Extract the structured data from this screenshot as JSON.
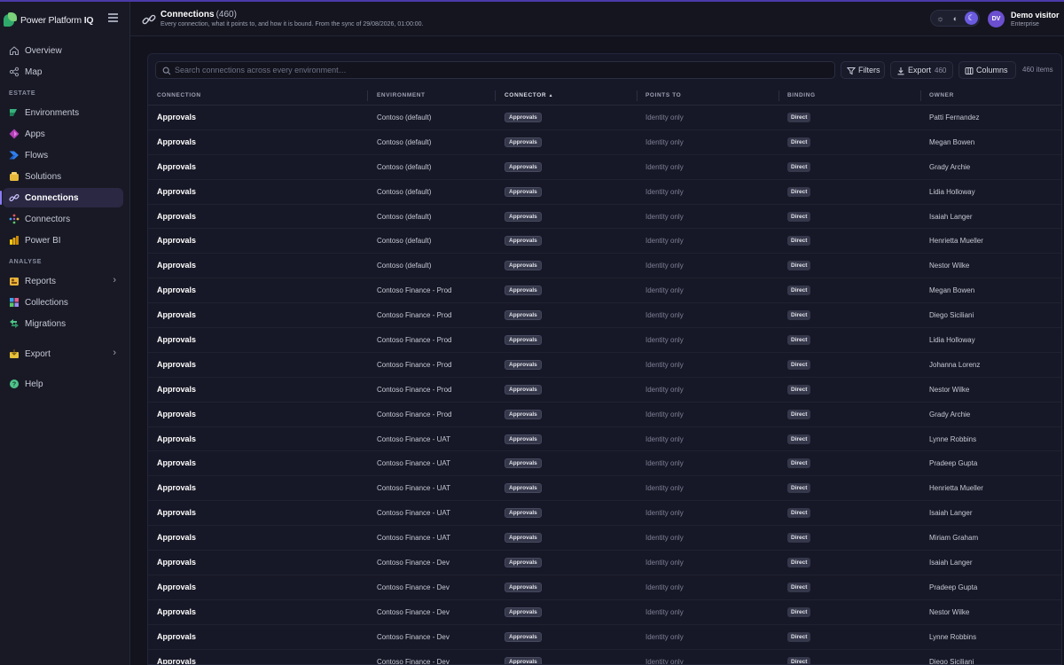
{
  "sidebar": {
    "brand": {
      "name": "Power Platform",
      "suffix": "IQ"
    },
    "top_items": [
      {
        "label": "Overview",
        "icon": "home-icon"
      },
      {
        "label": "Map",
        "icon": "share-nodes-icon"
      }
    ],
    "sections": [
      {
        "title": "ESTATE",
        "items": [
          {
            "label": "Environments",
            "icon": "environments-icon"
          },
          {
            "label": "Apps",
            "icon": "apps-icon"
          },
          {
            "label": "Flows",
            "icon": "flows-icon"
          },
          {
            "label": "Solutions",
            "icon": "solutions-icon"
          },
          {
            "label": "Connections",
            "icon": "connections-icon",
            "active": true
          },
          {
            "label": "Connectors",
            "icon": "connectors-icon"
          },
          {
            "label": "Power BI",
            "icon": "powerbi-icon"
          }
        ]
      },
      {
        "title": "ANALYSE",
        "items": [
          {
            "label": "Reports",
            "icon": "reports-icon",
            "chevron": true
          },
          {
            "label": "Collections",
            "icon": "collections-icon"
          },
          {
            "label": "Migrations",
            "icon": "migrations-icon"
          }
        ]
      }
    ],
    "export": {
      "label": "Export",
      "icon": "export-icon"
    },
    "help": {
      "label": "Help",
      "icon": "help-icon"
    }
  },
  "header": {
    "title": "Connections",
    "count": "(460)",
    "subtitle": "Every connection, what it points to, and how it is bound. From the sync of 29/08/2026, 01:00:00.",
    "user": {
      "initials": "DV",
      "name": "Demo visitor",
      "plan": "Enterprise"
    },
    "theme": {
      "options": [
        "sun-icon",
        "contrast-icon",
        "moon-icon"
      ],
      "selected": "moon-icon"
    }
  },
  "toolbar": {
    "search_placeholder": "Search connections across every environment…",
    "filters_label": "Filters",
    "export_label": "Export",
    "export_count": "460",
    "columns_label": "Columns",
    "items_count": "460 items"
  },
  "table": {
    "columns": [
      "CONNECTION",
      "ENVIRONMENT",
      "CONNECTOR",
      "POINTS TO",
      "BINDING",
      "OWNER"
    ],
    "sorted_column": "CONNECTOR",
    "sort_indicator": "▲",
    "rows": [
      {
        "connection": "Approvals",
        "environment": "Contoso (default)",
        "connector": "Approvals",
        "points_to": "Identity only",
        "binding": "Direct",
        "owner": "Patti Fernandez"
      },
      {
        "connection": "Approvals",
        "environment": "Contoso (default)",
        "connector": "Approvals",
        "points_to": "Identity only",
        "binding": "Direct",
        "owner": "Megan Bowen"
      },
      {
        "connection": "Approvals",
        "environment": "Contoso (default)",
        "connector": "Approvals",
        "points_to": "Identity only",
        "binding": "Direct",
        "owner": "Grady Archie"
      },
      {
        "connection": "Approvals",
        "environment": "Contoso (default)",
        "connector": "Approvals",
        "points_to": "Identity only",
        "binding": "Direct",
        "owner": "Lidia Holloway"
      },
      {
        "connection": "Approvals",
        "environment": "Contoso (default)",
        "connector": "Approvals",
        "points_to": "Identity only",
        "binding": "Direct",
        "owner": "Isaiah Langer"
      },
      {
        "connection": "Approvals",
        "environment": "Contoso (default)",
        "connector": "Approvals",
        "points_to": "Identity only",
        "binding": "Direct",
        "owner": "Henrietta Mueller"
      },
      {
        "connection": "Approvals",
        "environment": "Contoso (default)",
        "connector": "Approvals",
        "points_to": "Identity only",
        "binding": "Direct",
        "owner": "Nestor Wilke"
      },
      {
        "connection": "Approvals",
        "environment": "Contoso Finance - Prod",
        "connector": "Approvals",
        "points_to": "Identity only",
        "binding": "Direct",
        "owner": "Megan Bowen"
      },
      {
        "connection": "Approvals",
        "environment": "Contoso Finance - Prod",
        "connector": "Approvals",
        "points_to": "Identity only",
        "binding": "Direct",
        "owner": "Diego Siciliani"
      },
      {
        "connection": "Approvals",
        "environment": "Contoso Finance - Prod",
        "connector": "Approvals",
        "points_to": "Identity only",
        "binding": "Direct",
        "owner": "Lidia Holloway"
      },
      {
        "connection": "Approvals",
        "environment": "Contoso Finance - Prod",
        "connector": "Approvals",
        "points_to": "Identity only",
        "binding": "Direct",
        "owner": "Johanna Lorenz"
      },
      {
        "connection": "Approvals",
        "environment": "Contoso Finance - Prod",
        "connector": "Approvals",
        "points_to": "Identity only",
        "binding": "Direct",
        "owner": "Nestor Wilke"
      },
      {
        "connection": "Approvals",
        "environment": "Contoso Finance - Prod",
        "connector": "Approvals",
        "points_to": "Identity only",
        "binding": "Direct",
        "owner": "Grady Archie"
      },
      {
        "connection": "Approvals",
        "environment": "Contoso Finance - UAT",
        "connector": "Approvals",
        "points_to": "Identity only",
        "binding": "Direct",
        "owner": "Lynne Robbins"
      },
      {
        "connection": "Approvals",
        "environment": "Contoso Finance - UAT",
        "connector": "Approvals",
        "points_to": "Identity only",
        "binding": "Direct",
        "owner": "Pradeep Gupta"
      },
      {
        "connection": "Approvals",
        "environment": "Contoso Finance - UAT",
        "connector": "Approvals",
        "points_to": "Identity only",
        "binding": "Direct",
        "owner": "Henrietta Mueller"
      },
      {
        "connection": "Approvals",
        "environment": "Contoso Finance - UAT",
        "connector": "Approvals",
        "points_to": "Identity only",
        "binding": "Direct",
        "owner": "Isaiah Langer"
      },
      {
        "connection": "Approvals",
        "environment": "Contoso Finance - UAT",
        "connector": "Approvals",
        "points_to": "Identity only",
        "binding": "Direct",
        "owner": "Miriam Graham"
      },
      {
        "connection": "Approvals",
        "environment": "Contoso Finance - Dev",
        "connector": "Approvals",
        "points_to": "Identity only",
        "binding": "Direct",
        "owner": "Isaiah Langer"
      },
      {
        "connection": "Approvals",
        "environment": "Contoso Finance - Dev",
        "connector": "Approvals",
        "points_to": "Identity only",
        "binding": "Direct",
        "owner": "Pradeep Gupta"
      },
      {
        "connection": "Approvals",
        "environment": "Contoso Finance - Dev",
        "connector": "Approvals",
        "points_to": "Identity only",
        "binding": "Direct",
        "owner": "Nestor Wilke"
      },
      {
        "connection": "Approvals",
        "environment": "Contoso Finance - Dev",
        "connector": "Approvals",
        "points_to": "Identity only",
        "binding": "Direct",
        "owner": "Lynne Robbins"
      },
      {
        "connection": "Approvals",
        "environment": "Contoso Finance - Dev",
        "connector": "Approvals",
        "points_to": "Identity only",
        "binding": "Direct",
        "owner": "Diego Siciliani"
      }
    ]
  },
  "colors": {
    "accent": "#6b5be0",
    "background": "#12131d",
    "sidebar": "#181925",
    "panel": "#171827"
  }
}
